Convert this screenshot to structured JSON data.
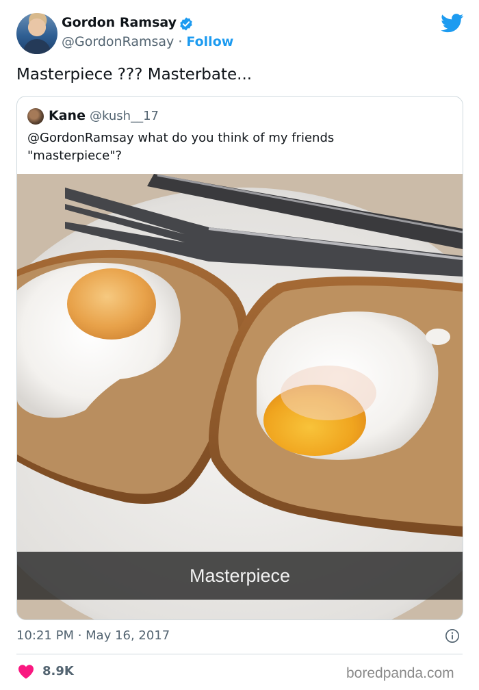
{
  "author": {
    "name": "Gordon Ramsay",
    "handle": "@GordonRamsay",
    "separator": " · ",
    "follow_label": "Follow",
    "verified": true
  },
  "tweet": {
    "text": "Masterpiece ??? Masterbate..."
  },
  "quoted_tweet": {
    "name": "Kane",
    "handle": "@kush__17",
    "text": "@GordonRamsay what do you think of my friends \"masterpiece\"?",
    "image_caption": "Masterpiece"
  },
  "footer": {
    "timestamp": "10:21 PM · May 16, 2017",
    "likes": "8.9K"
  },
  "watermark": "boredpanda.com",
  "colors": {
    "accent": "#1d9bf0",
    "like": "#f91880",
    "secondary_text": "#536471",
    "border": "#cfd9de"
  }
}
